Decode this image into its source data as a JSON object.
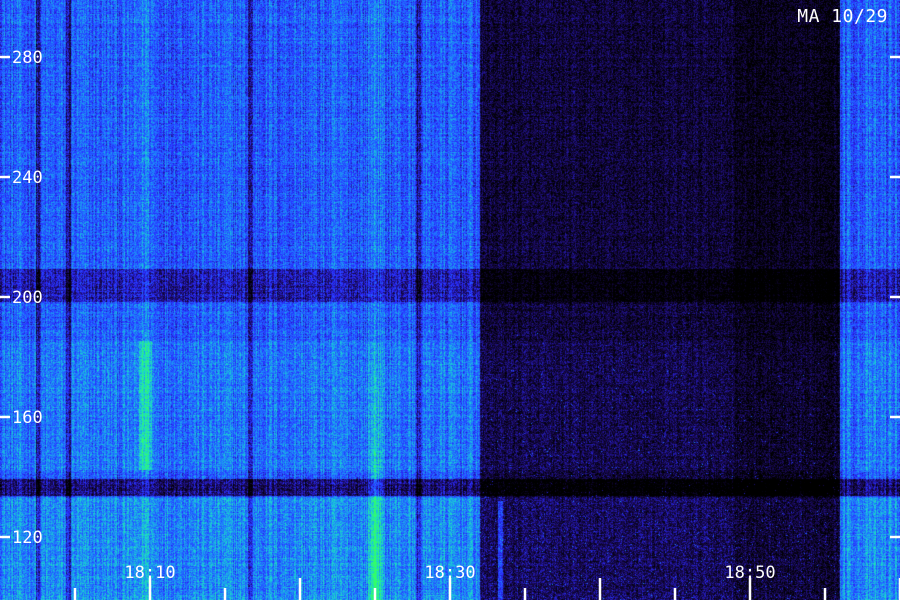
{
  "chart_data": {
    "type": "heatmap",
    "title": "",
    "badge_text": "MA 10/29",
    "xlabel": "",
    "ylabel": "",
    "x_ticks": [
      "18:10",
      "18:30",
      "18:50"
    ],
    "y_ticks": [
      120,
      160,
      200,
      240,
      280
    ],
    "y_range": [
      105,
      295
    ],
    "x_range": [
      "18:03",
      "18:62"
    ],
    "grid": false,
    "colormap": [
      "#000000",
      "#1a0a5a",
      "#2a2aff",
      "#1f7bff",
      "#19d6d0",
      "#33ff66"
    ],
    "segments": [
      {
        "from": "18:03",
        "to": "18:32",
        "intensity": "high"
      },
      {
        "from": "18:32",
        "to": "18:49",
        "intensity": "low"
      },
      {
        "from": "18:49",
        "to": "18:56",
        "intensity": "very-low"
      },
      {
        "from": "18:56",
        "to": "18:62",
        "intensity": "high"
      }
    ]
  }
}
